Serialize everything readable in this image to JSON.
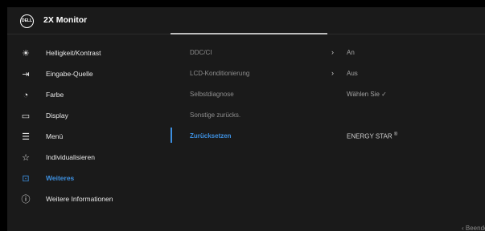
{
  "header": {
    "logo_text": "DELL",
    "title": "2X Monitor"
  },
  "sidebar": {
    "items": [
      {
        "label": "Helligkeit/Kontrast",
        "icon": "brightness-icon"
      },
      {
        "label": "Eingabe-Quelle",
        "icon": "input-source-icon"
      },
      {
        "label": "Farbe",
        "icon": "color-icon"
      },
      {
        "label": "Display",
        "icon": "display-icon"
      },
      {
        "label": "Menü",
        "icon": "menu-icon"
      },
      {
        "label": "Individualisieren",
        "icon": "star-icon"
      },
      {
        "label": "Weiteres",
        "icon": "others-icon",
        "active": true
      },
      {
        "label": "Weitere Informationen",
        "icon": "info-icon"
      }
    ]
  },
  "content": {
    "options": [
      {
        "label": "DDC/CI",
        "arrow": "›",
        "value": "An"
      },
      {
        "label": "LCD-Konditionierung",
        "arrow": "›",
        "value": "Aus"
      },
      {
        "label": "Selbstdiagnose",
        "value": "Wählen Sie ✓"
      },
      {
        "label": "Sonstige zurücks.",
        "value": ""
      },
      {
        "label": "Zurücksetzen",
        "value": "ENERGY STAR",
        "value_sup": "®",
        "selected": true
      }
    ]
  },
  "footer": {
    "exit_label": "‹ Beenden"
  },
  "colors": {
    "background": "#1a1a1a",
    "accent": "#3d8fdf",
    "text": "#e8e8e8",
    "muted": "#8e8e8e"
  }
}
